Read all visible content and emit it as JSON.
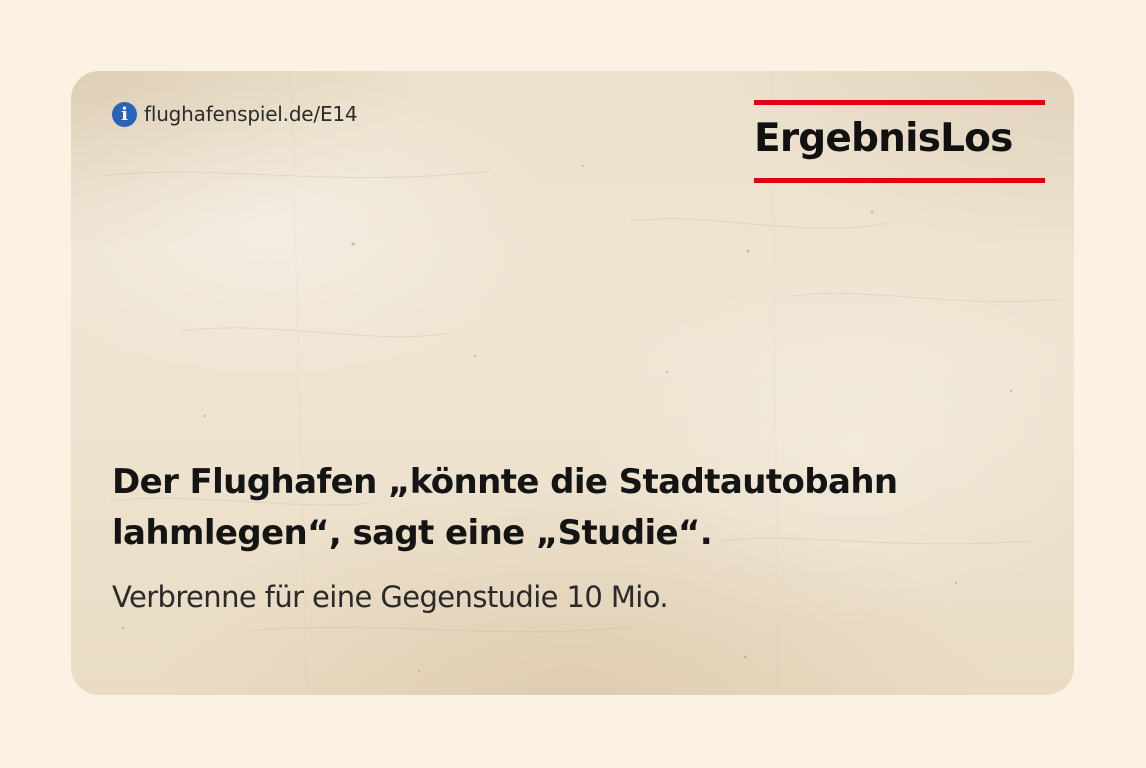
{
  "card": {
    "link_text": "flughafenspiel.de/E14",
    "info_icon": "info-icon",
    "brand": "ErgebnisLos",
    "headline_line1": "Der Flughafen „könnte die Stadtautobahn",
    "headline_line2": "lahmlegen“, sagt eine „Studie“.",
    "subline": "Verbrenne für eine Gegenstudie 10 Mio."
  },
  "colors": {
    "page_background": "#fbf2e4",
    "paper": "#ece1cd",
    "brand_rule": "#e0000f",
    "info_icon": "#2a63b8",
    "text": "#141414"
  }
}
